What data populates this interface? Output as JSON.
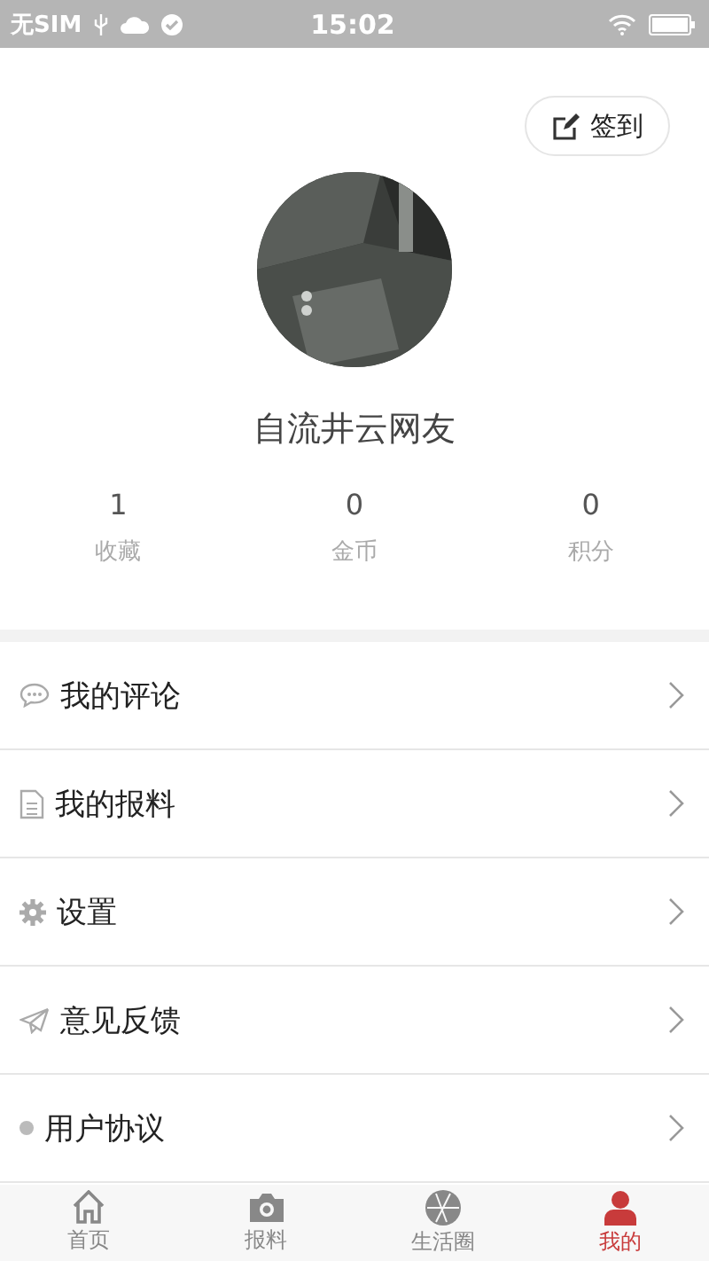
{
  "status_bar": {
    "carrier": "无SIM",
    "time": "15:02"
  },
  "checkin_button": {
    "label": "签到"
  },
  "profile": {
    "name": "自流井云网友"
  },
  "stats": [
    {
      "value": "1",
      "label": "收藏"
    },
    {
      "value": "0",
      "label": "金币"
    },
    {
      "value": "0",
      "label": "积分"
    }
  ],
  "menu": [
    {
      "kind": "comment",
      "label": "我的评论"
    },
    {
      "kind": "document",
      "label": "我的报料"
    },
    {
      "kind": "gear",
      "label": "设置"
    },
    {
      "kind": "send",
      "label": "意见反馈"
    },
    {
      "kind": "dot",
      "label": "用户协议"
    }
  ],
  "tabs": [
    {
      "kind": "home",
      "label": "首页",
      "selected": false
    },
    {
      "kind": "camera",
      "label": "报料",
      "selected": false
    },
    {
      "kind": "aperture",
      "label": "生活圈",
      "selected": false
    },
    {
      "kind": "person",
      "label": "我的",
      "selected": true
    }
  ]
}
